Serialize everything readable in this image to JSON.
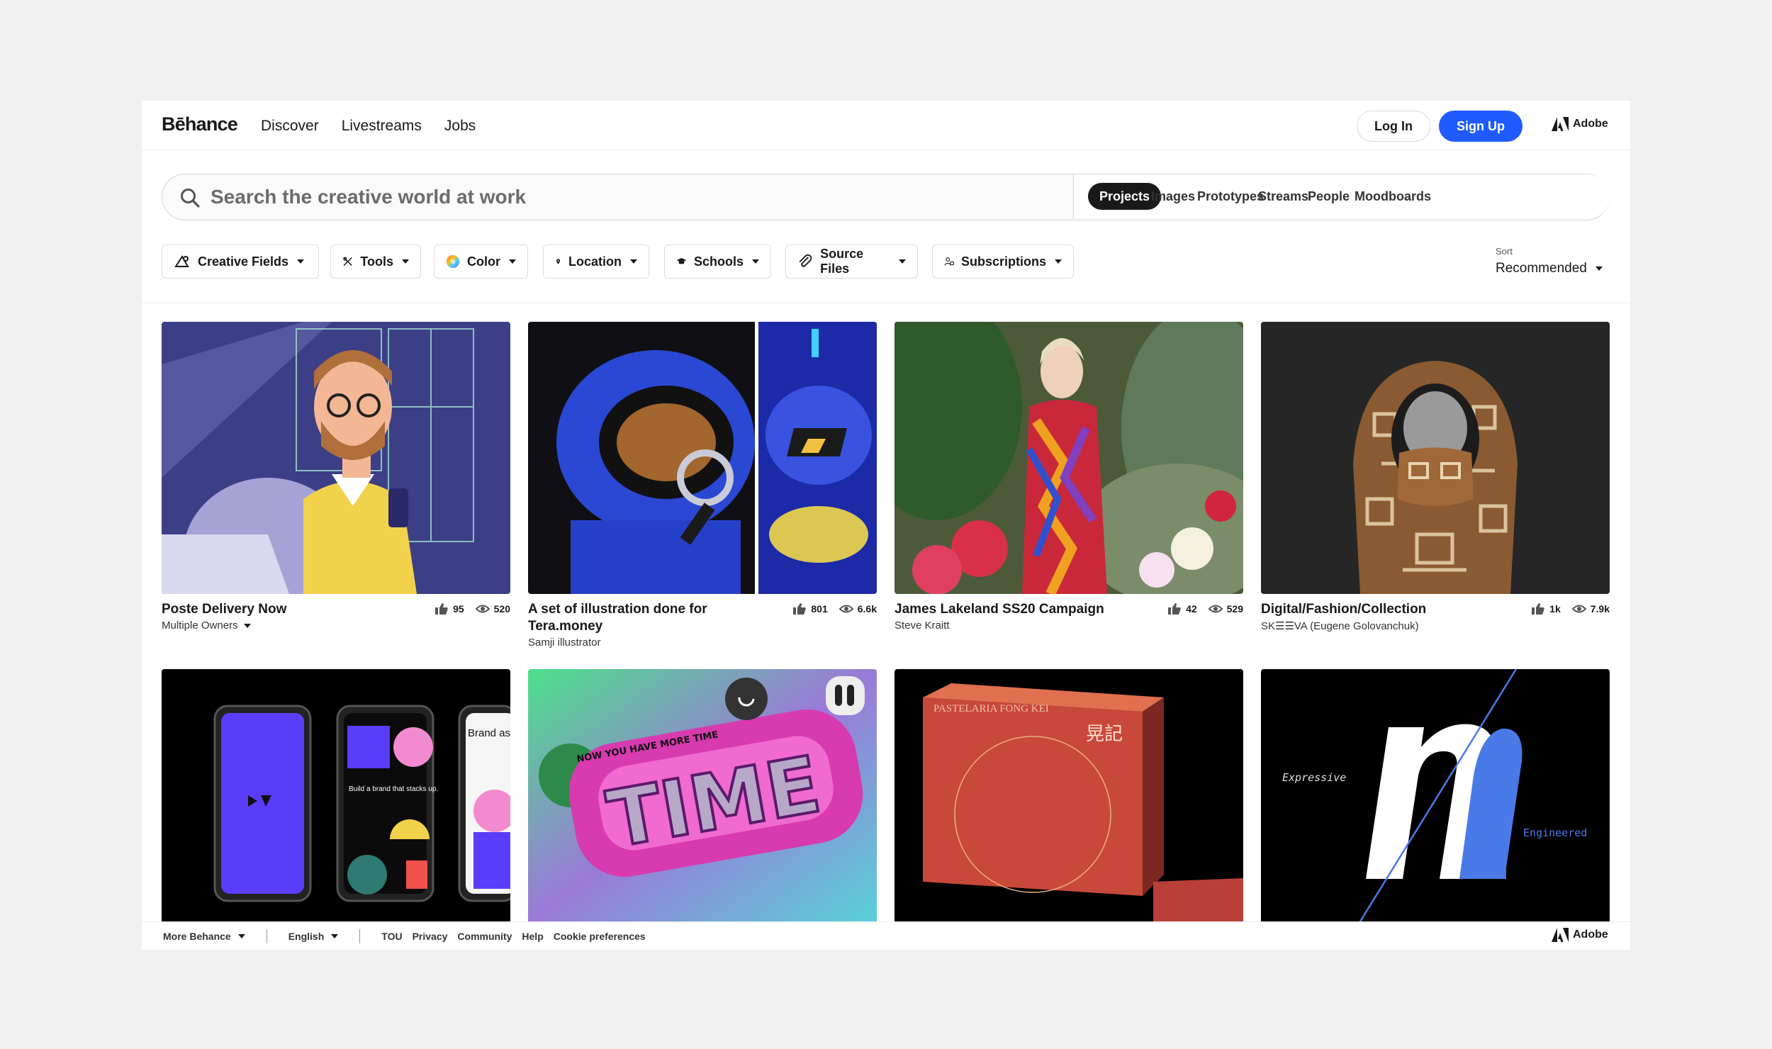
{
  "brand": {
    "logo": "Bēhance"
  },
  "nav": {
    "links": [
      "Discover",
      "Livestreams",
      "Jobs"
    ]
  },
  "auth": {
    "login": "Log In",
    "signup": "Sign Up"
  },
  "adobe": {
    "label": "Adobe"
  },
  "search": {
    "placeholder": "Search the creative world at work",
    "tabs": [
      "Projects",
      "Images",
      "Prototypes",
      "Streams",
      "People",
      "Moodboards"
    ],
    "active_tab": "Projects"
  },
  "filters": [
    {
      "label": "Creative Fields",
      "icon": "creative-fields-icon"
    },
    {
      "label": "Tools",
      "icon": "tools-icon"
    },
    {
      "label": "Color",
      "icon": "color-wheel-icon"
    },
    {
      "label": "Location",
      "icon": "location-pin-icon"
    },
    {
      "label": "Schools",
      "icon": "graduation-cap-icon"
    },
    {
      "label": "Source Files",
      "icon": "paperclip-icon"
    },
    {
      "label": "Subscriptions",
      "icon": "subscriptions-icon"
    }
  ],
  "sort": {
    "label": "Sort",
    "value": "Recommended"
  },
  "projects": [
    {
      "title": "Poste Delivery Now",
      "owner": "Multiple Owners",
      "likes": "95",
      "views": "520"
    },
    {
      "title": "A set of illustration done for Tera.money",
      "owner": "Samji illustrator",
      "likes": "801",
      "views": "6.6k"
    },
    {
      "title": "James Lakeland SS20 Campaign",
      "owner": "Steve Kraitt",
      "likes": "42",
      "views": "529"
    },
    {
      "title": "Digital/Fashion/Collection",
      "owner": "SK☰☰VA (Eugene Golovanchuk)",
      "likes": "1k",
      "views": "7.9k"
    }
  ],
  "row2_text": {
    "phone_small": "Build a brand that stacks up.",
    "phone_brand": "Brand assets all in one place.",
    "time_word": "TIME",
    "time_ribbon": "NOW YOU HAVE MORE TIME",
    "pastelaria": "PASTELARIA FONG KEI",
    "chinese": "晃記",
    "expressive": "Expressive",
    "engineered": "Engineered"
  },
  "footer": {
    "more": "More Behance",
    "language": "English",
    "links": [
      "TOU",
      "Privacy",
      "Community",
      "Help",
      "Cookie preferences"
    ]
  },
  "colors": {
    "accent": "#1f5bff",
    "text": "#191919",
    "background": "#f0f0f1"
  }
}
